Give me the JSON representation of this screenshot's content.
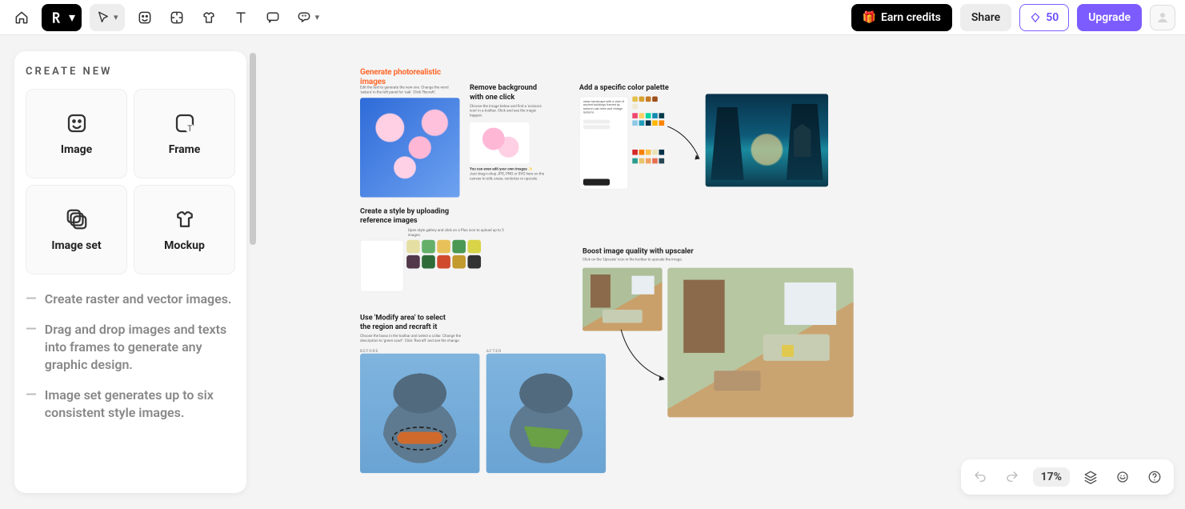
{
  "topbar": {
    "earn_label": "Earn credits",
    "share_label": "Share",
    "credits": "50",
    "upgrade_label": "Upgrade"
  },
  "sidebar": {
    "title": "CREATE NEW",
    "cards": [
      {
        "label": "Image"
      },
      {
        "label": "Frame"
      },
      {
        "label": "Image set"
      },
      {
        "label": "Mockup"
      }
    ],
    "tips": [
      "Create raster and vector images.",
      "Drag and drop images and texts into frames to generate any graphic design.",
      "Image set generates up to six consistent style images."
    ]
  },
  "canvas": {
    "section1": {
      "heading": "Generate photorealistic images",
      "subtext": "Edit the text to generate the new one. Change the word 'sakura' in the left panel for 'oak'. Click 'Recraft'.",
      "removebg_title": "Remove background with one click",
      "removebg_sub": "Choose the image below and find a 'scissors icon' in a toolbar. Click and see the magic happen.",
      "removebg_note": "You can even edit your own images ✨",
      "removebg_note2": "Just drag-n-drop JPG, PNG or SVG here on the canvas to edit, erase, vectorize or upscale."
    },
    "section2": {
      "title": "Create a style by uploading reference images",
      "subtext": "Open style gallery and click on a Plus icon to upload up to 5 images."
    },
    "section3": {
      "title": "Use 'Modify area' to select the region and recraft it",
      "subtext": "Choose the lasso in the toolbar and select a collar. Change the description to 'green scarf'. Click 'Recraft' and see the change.",
      "before": "BEFORE",
      "after": "AFTER"
    },
    "section4": {
      "title": "Add a specific color palette",
      "panel_prompt": "urban landscape with a view of ancient buildings framed by autumn oak trees and vintage lanterns"
    },
    "section5": {
      "title": "Boost image quality with upscaler",
      "subtext": "Click on the 'Upscale' icon in the toolbar to upscale the image."
    }
  },
  "bottombar": {
    "zoom": "17%"
  }
}
